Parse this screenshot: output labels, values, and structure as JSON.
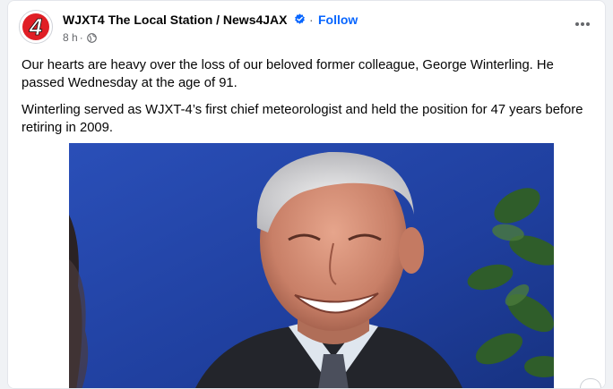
{
  "post": {
    "page_name": "WJXT4 The Local Station / News4JAX",
    "separator": "·",
    "follow_label": "Follow",
    "time": "8 h",
    "time_sep": "·",
    "paragraphs": [
      "Our hearts are heavy over the loss of our beloved former colleague, George Winterling. He passed Wednesday at the age of 91.",
      "Winterling served as WJXT-4’s first chief meteorologist and held the position for 47 years before retiring in 2009."
    ],
    "logo_text": "4"
  },
  "icons": {
    "verified": "verified-badge-icon",
    "audience": "globe-icon",
    "more": "more-options-icon"
  },
  "colors": {
    "accent": "#0866ff",
    "logo_red": "#e01e25",
    "secondary_text": "#65676b"
  }
}
